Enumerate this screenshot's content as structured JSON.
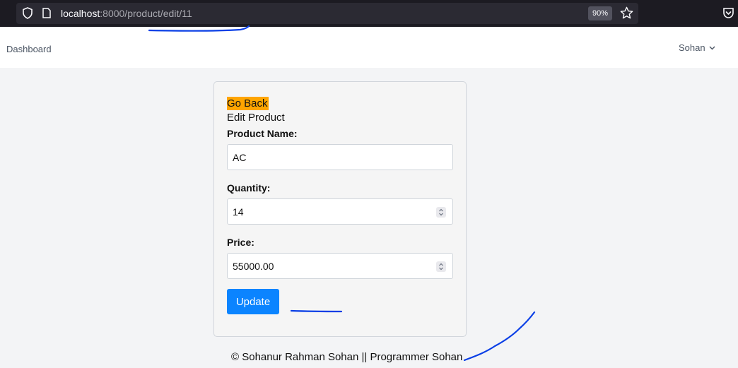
{
  "browser": {
    "url_host": "localhost",
    "url_rest": ":8000/product/edit/11",
    "zoom": "90%",
    "icons": [
      "shield-icon",
      "page-icon",
      "star-icon",
      "pocket-icon"
    ]
  },
  "nav": {
    "dashboard_label": "Dashboard",
    "user_name": "Sohan"
  },
  "form": {
    "go_back": "Go Back",
    "title": "Edit Product",
    "product_name_label": "Product Name:",
    "product_name_value": "AC",
    "quantity_label": "Quantity:",
    "quantity_value": "14",
    "price_label": "Price:",
    "price_value": "55000.00",
    "update_label": "Update"
  },
  "footer": {
    "text": "© Sohanur Rahman Sohan || Programmer Sohan"
  },
  "colors": {
    "go_back_bg": "#ffa500",
    "update_bg": "#0b84ff",
    "annotation": "#0a3fe6"
  }
}
